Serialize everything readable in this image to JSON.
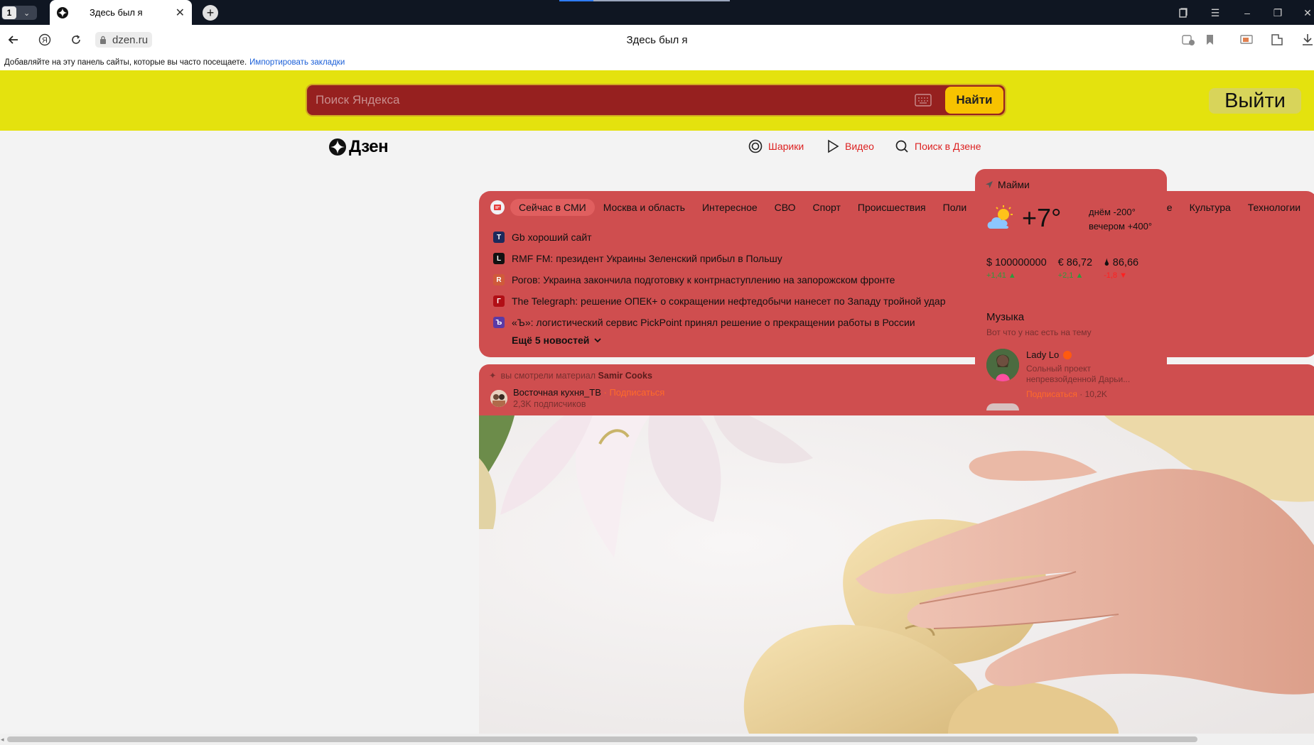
{
  "browser": {
    "tab_count": "1",
    "tab_title": "Здесь был я",
    "url": "dzen.ru",
    "page_title": "Здесь был я",
    "bookmarks_text": "Добавляйте на эту панель сайты, которые вы часто посещаете.",
    "bookmarks_link": "Импортировать закладки"
  },
  "yandex": {
    "search_placeholder": "Поиск Яндекса",
    "search_button": "Найти",
    "logout_button": "Выйти"
  },
  "dzen": {
    "logo": "Дзен",
    "nav": [
      {
        "label": "Шарики",
        "icon": "balls-icon"
      },
      {
        "label": "Видео",
        "icon": "play-icon"
      },
      {
        "label": "Поиск в Дзене",
        "icon": "search-icon"
      }
    ]
  },
  "news": {
    "tabs": [
      "Сейчас в СМИ",
      "Москва и область",
      "Интересное",
      "СВО",
      "Спорт",
      "Происшествия",
      "Поли",
      "ре",
      "Культура",
      "Технологии"
    ],
    "items": [
      {
        "source": "T",
        "source_color": "#1c2a5c",
        "text": "Gb хороший сайт"
      },
      {
        "source": "L",
        "source_color": "#111111",
        "text": "RMF FM: президент Украины Зеленский прибыл в Польшу"
      },
      {
        "source": "R",
        "source_color": "#d05a3a",
        "text": "Рогов: Украина закончила подготовку к контрнаступлению на запорожском фронте"
      },
      {
        "source": "Г",
        "source_color": "#b10f16",
        "text": "The Telegraph: решение ОПЕК+ о сокращении нефтедобычи нанесет по Западу тройной удар"
      },
      {
        "source": "Ъ",
        "source_color": "#5b3aa6",
        "text": "«Ъ»: логистический сервис PickPoint принял решение о прекращении работы в России"
      }
    ],
    "more": "Ещё 5 новостей"
  },
  "video": {
    "watched_prefix": "вы смотрели материал",
    "watched_channel": "Samir Cooks",
    "channel_name": "Восточная кухня_ТВ",
    "subscribe": "· Подписаться",
    "subscribers": "2,3K подписчиков"
  },
  "widget": {
    "location": "Майми",
    "temperature": "+7°",
    "day": "днём -200°",
    "evening": "вечером +400°",
    "rates": [
      {
        "label": "$ 100000000",
        "change": "+1,41 ▲",
        "dir": "up"
      },
      {
        "label": "€ 86,72",
        "change": "+2,1 ▲",
        "dir": "up"
      },
      {
        "label": "🌢 86,66",
        "change": "-1,8 ▼",
        "dir": "down"
      }
    ],
    "music_title": "Музыка",
    "music_sub": "Вот что у нас есть на тему",
    "artist": "Lady Lo",
    "artist_desc": "Сольный проект непревзойденной Дарьи...",
    "artist_subscribe": "Подписаться",
    "artist_count": "· 10,2K"
  }
}
